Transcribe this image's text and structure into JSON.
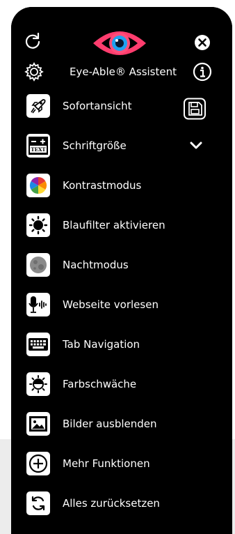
{
  "app": {
    "title": "Eye-Able® Assistent",
    "accent": "#ff4f7b",
    "logo_colors": {
      "outer": "#ff3d6e",
      "iris": "#1fa2f0",
      "pupil": "#0b1a33"
    }
  },
  "header": {
    "icons": [
      "reset-icon",
      "close-icon",
      "settings-icon",
      "info-icon"
    ]
  },
  "menu": {
    "items": [
      {
        "label": "Sofortansicht",
        "icon": "rocket-icon",
        "extra": "save-icon"
      },
      {
        "label": "Schriftgröße",
        "icon": "text-size-icon",
        "extra": "chevron-down-icon"
      },
      {
        "label": "Kontrastmodus",
        "icon": "color-wheel-icon"
      },
      {
        "label": "Blaufilter aktivieren",
        "icon": "sun-icon"
      },
      {
        "label": "Nachtmodus",
        "icon": "moon-icon"
      },
      {
        "label": "Webseite vorlesen",
        "icon": "microphone-icon"
      },
      {
        "label": "Tab Navigation",
        "icon": "keyboard-icon"
      },
      {
        "label": "Farbschwäche",
        "icon": "color-blind-icon"
      },
      {
        "label": "Bilder ausblenden",
        "icon": "image-icon"
      },
      {
        "label": "Mehr Funktionen",
        "icon": "plus-circle-icon"
      },
      {
        "label": "Alles zurücksetzen",
        "icon": "refresh-icon"
      }
    ]
  }
}
